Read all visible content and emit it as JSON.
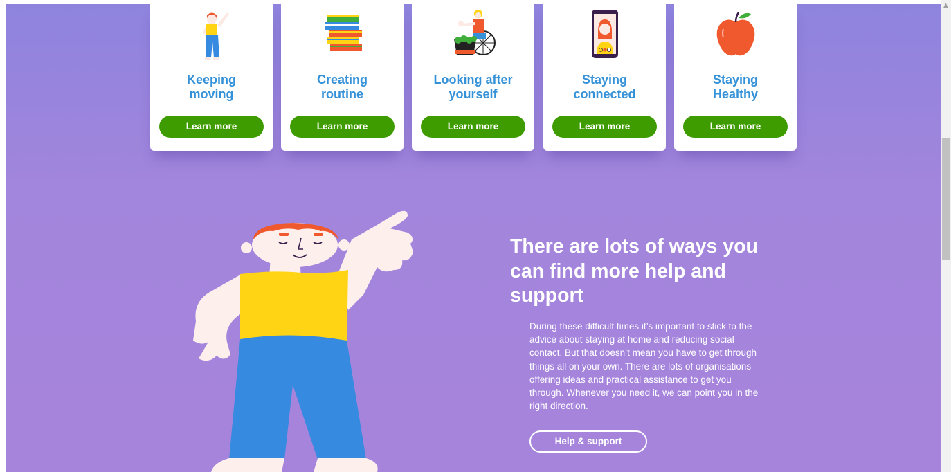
{
  "cards": [
    {
      "title": "Keeping\nmoving",
      "button": "Learn more",
      "icon": "pointing-person-icon"
    },
    {
      "title": "Creating\nroutine",
      "button": "Learn more",
      "icon": "book-stack-icon"
    },
    {
      "title": "Looking after\nyourself",
      "button": "Learn more",
      "icon": "wheelchair-gardening-icon"
    },
    {
      "title": "Staying\nconnected",
      "button": "Learn more",
      "icon": "phone-video-call-icon"
    },
    {
      "title": "Staying\nHealthy",
      "button": "Learn more",
      "icon": "apple-icon"
    }
  ],
  "hero": {
    "title": "There are lots of ways you can find more help and support",
    "body": "During these difficult times it’s important to stick to the advice about staying at home and reducing social contact. But that doesn’t mean you have to get through things all on your own. There are lots of organisations offering ideas and practical assistance to get you through. Whenever you need it, we can point you in the right direction.",
    "button": "Help & support",
    "illustration": "pointing-person-illustration"
  },
  "colors": {
    "background_top": "#8e84de",
    "background": "#a784dc",
    "card_title": "#3592d8",
    "button_green": "#3f9c00",
    "shirt_yellow": "#ffd414",
    "trousers_blue": "#368ae0",
    "hair_orange": "#f0582e"
  }
}
